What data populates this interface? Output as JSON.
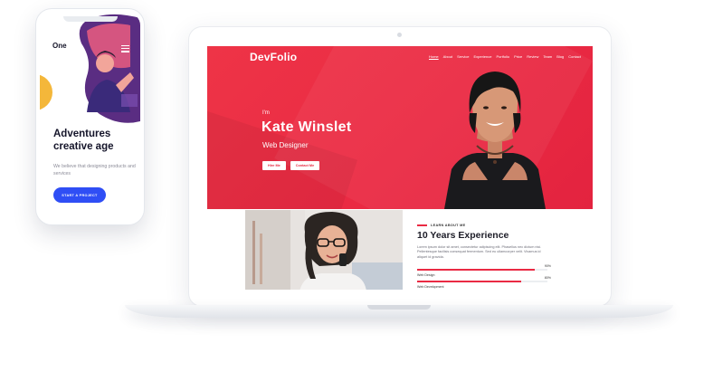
{
  "laptop": {
    "brand": "DevFolio",
    "nav": [
      "Home",
      "About",
      "Service",
      "Experience",
      "Portfolio",
      "Price",
      "Review",
      "Team",
      "Blog",
      "Contact"
    ],
    "hero": {
      "greeting": "I'm",
      "name": "Kate Winslet",
      "role": "Web Designer",
      "buttons": [
        "Hire Me",
        "Contact Me"
      ]
    },
    "about": {
      "kicker": "LEARN ABOUT ME",
      "title": "10 Years Experience",
      "paragraph": "Lorem ipsum dolor sit amet, consectetur adipiscing elit. Phasellus nec dictum nisi. Pellentesque facilisis consequat fermentum. Sed eu ullamcorper velit. Vivamus id aliquet id gravida.",
      "skills": [
        {
          "label": "Web Design",
          "percent": "90%",
          "value": 0.9
        },
        {
          "label": "Web Development",
          "percent": "80%",
          "value": 0.8
        }
      ]
    },
    "accent_color": "#ea2a43"
  },
  "phone": {
    "logo": "One",
    "title": "Adventures creative age",
    "subtitle": "We believe that designing products and services",
    "cta": "START A PROJECT",
    "cta_color": "#2f4ef5",
    "menu_icon": "hamburger-icon"
  }
}
